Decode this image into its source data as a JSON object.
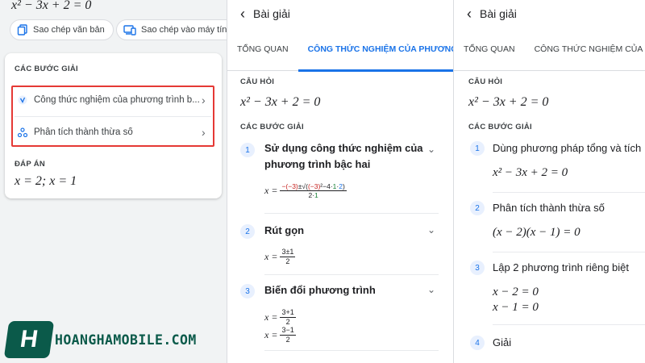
{
  "panel1": {
    "equation": "x² − 3x + 2 = 0",
    "chips": [
      {
        "label": "Sao chép văn bản",
        "icon": "copy-icon"
      },
      {
        "label": "Sao chép vào máy tính",
        "icon": "computer-icon"
      }
    ],
    "steps_heading": "CÁC BƯỚC GIẢI",
    "steps": [
      {
        "label": "Công thức nghiệm của phương trình b...",
        "icon": "formula-icon"
      },
      {
        "label": "Phân tích thành thừa số",
        "icon": "factor-icon"
      }
    ],
    "answer_heading": "ĐÁP ÁN",
    "answer": "x = 2; x = 1"
  },
  "panel2": {
    "title": "Bài giải",
    "tabs": [
      "TỔNG QUAN",
      "CÔNG THỨC NGHIỆM CỦA PHƯƠNG TRÌNH"
    ],
    "active_tab": 1,
    "question_heading": "CÂU HỎI",
    "question": "x² − 3x + 2 = 0",
    "steps_heading": "CÁC BƯỚC GIẢI",
    "steps": [
      {
        "num": "1",
        "title": "Sử dụng công thức nghiệm của phương trình bậc hai"
      },
      {
        "num": "2",
        "title": "Rút gọn"
      },
      {
        "num": "3",
        "title": "Biến đổi phương trình"
      }
    ]
  },
  "panel3": {
    "title": "Bài giải",
    "tabs": [
      "TỔNG QUAN",
      "CÔNG THỨC NGHIỆM CỦA PHƯƠNG TRÌNH"
    ],
    "question_heading": "CÂU HỎI",
    "question": "x² − 3x + 2 = 0",
    "steps_heading": "CÁC BƯỚC GIẢI",
    "steps": [
      {
        "num": "1",
        "title": "Dùng phương pháp tổng và tích"
      },
      {
        "num": "2",
        "title": "Phân tích thành thừa số"
      },
      {
        "num": "3",
        "title": "Lập 2 phương trình riêng biệt"
      },
      {
        "num": "4",
        "title": "Giải"
      }
    ],
    "step1_eq": "x² − 3x + 2 = 0",
    "step2_eq": "(x − 2)(x − 1) = 0",
    "step3_eq1": "x − 2 = 0",
    "step3_eq2": "x − 1 = 0"
  },
  "brand": {
    "name": "HOANGHAMOBILE.COM",
    "logo_letter": "H",
    "color": "#0b5a4a"
  },
  "colors": {
    "accent": "#1a73e8",
    "highlight": "#e53935"
  }
}
